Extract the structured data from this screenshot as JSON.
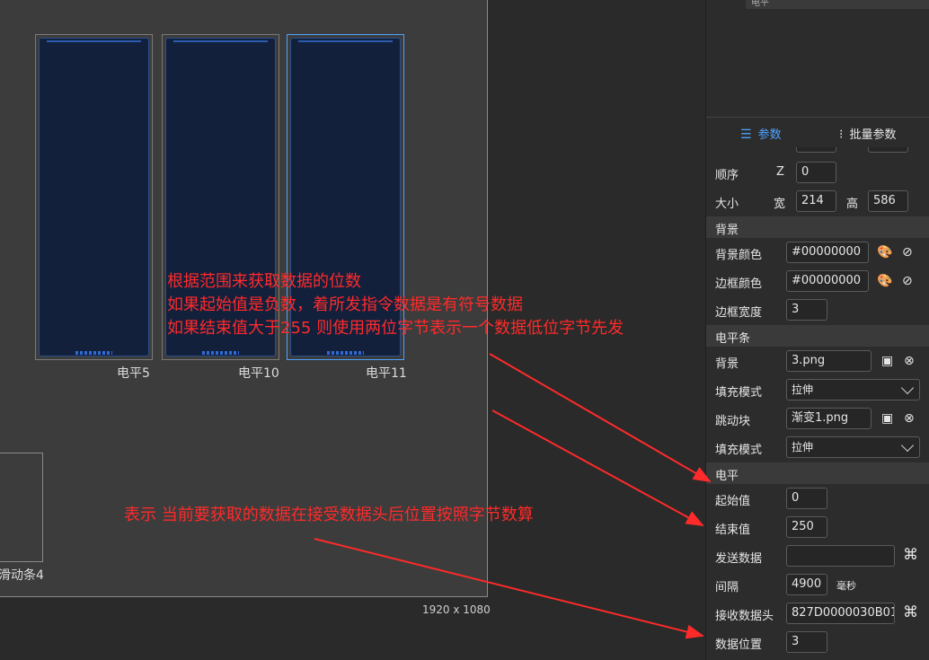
{
  "canvas": {
    "panels": [
      {
        "label": "电平5"
      },
      {
        "label": "电平10"
      },
      {
        "label": "电平11"
      }
    ],
    "scroll_label": "滑动条4",
    "resolution": "1920 x 1080"
  },
  "annotations": {
    "note1_line1": "根据范围来获取数据的位数",
    "note1_line2": "如果起始值是负数，着所发指令数据是有符号数据",
    "note1_line3": "如果结束值大于255 则使用两位字节表示一个数据低位字节先发",
    "note2": "表示 当前要获取的数据在接受数据头后位置按照字节数算",
    "color": "#ff2a2a"
  },
  "sidebar": {
    "tree_item": "电平",
    "tabs": [
      {
        "label": "参数",
        "icon": "list-icon",
        "active": true
      },
      {
        "label": "批量参数",
        "icon": "batch-icon",
        "active": false
      }
    ],
    "order": {
      "label": "顺序",
      "axis": "Z",
      "value": "0"
    },
    "size": {
      "label": "大小",
      "width_label": "宽",
      "width": "214",
      "height_label": "高",
      "height": "586"
    },
    "background_section": "背景",
    "bg_color": {
      "label": "背景颜色",
      "value": "#00000000"
    },
    "border_color": {
      "label": "边框颜色",
      "value": "#00000000"
    },
    "border_width": {
      "label": "边框宽度",
      "value": "3"
    },
    "level_bar_section": "电平条",
    "bar_bg": {
      "label": "背景",
      "value": "3.png"
    },
    "fill_mode1": {
      "label": "填充模式",
      "value": "拉伸"
    },
    "jump_block": {
      "label": "跳动块",
      "value": "渐变1.png"
    },
    "fill_mode2": {
      "label": "填充模式",
      "value": "拉伸"
    },
    "level_section": "电平",
    "start": {
      "label": "起始值",
      "value": "0"
    },
    "end": {
      "label": "结束值",
      "value": "250"
    },
    "send": {
      "label": "发送数据",
      "value": ""
    },
    "interval": {
      "label": "间隔",
      "value": "4900",
      "unit": "毫秒"
    },
    "recv_header": {
      "label": "接收数据头",
      "value": "827D0000030B01("
    },
    "data_pos": {
      "label": "数据位置",
      "value": "3"
    }
  }
}
